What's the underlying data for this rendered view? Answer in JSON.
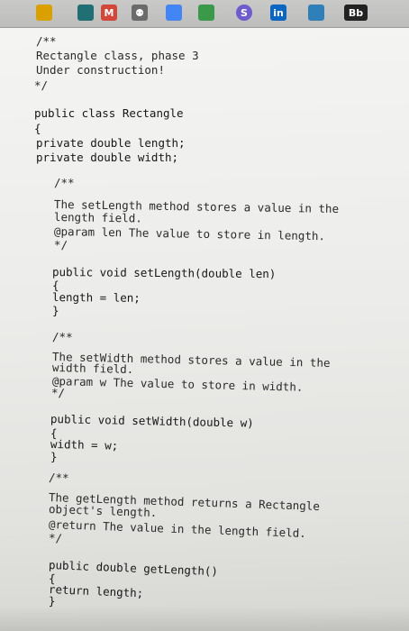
{
  "toolbar": {
    "icons": [
      {
        "name": "tab-icon",
        "color": "#d9a000"
      },
      {
        "name": "app-icon",
        "color": "#1f6f74"
      },
      {
        "name": "gmail-icon",
        "color": "#d44638",
        "glyph": "M"
      },
      {
        "name": "app-icon",
        "color": "#6b6b6b",
        "glyph": "⚉"
      },
      {
        "name": "docs-icon",
        "color": "#4285f4"
      },
      {
        "name": "app-icon",
        "color": "#3a9a4a"
      },
      {
        "name": "dollar-icon",
        "color": "#6d5bd0",
        "glyph": "S"
      },
      {
        "name": "linkedin-icon",
        "color": "#0a66c2",
        "glyph": "in"
      },
      {
        "name": "app-icon",
        "color": "#2f7fb8"
      },
      {
        "name": "blackboard-icon",
        "color": "#222222",
        "glyph": "Bb"
      }
    ]
  },
  "code": {
    "lines": [
      "/**",
      "   Rectangle class, phase 3",
      "   Under construction!",
      "*/",
      "",
      "public class Rectangle",
      "{",
      "   private double length;",
      "   private double width;",
      "",
      "   /**",
      "      The setLength method stores a value in the",
      "      length field.",
      "      @param len The value to store in length.",
      "   */",
      "",
      "   public void setLength(double len)",
      "   {",
      "      length = len;",
      "   }",
      "",
      "   /**",
      "      The setWidth method stores a value in the",
      "      width field.",
      "      @param w The value to store in width.",
      "   */",
      "",
      "   public void setWidth(double w)",
      "   {",
      "      width = w;",
      "   }",
      "",
      "   /**",
      "      The getLength method returns a Rectangle",
      "      object's length.",
      "      @return The value in the length field.",
      "   */",
      "",
      "   public double getLength()",
      "   {",
      "      return length;",
      "   }"
    ]
  }
}
